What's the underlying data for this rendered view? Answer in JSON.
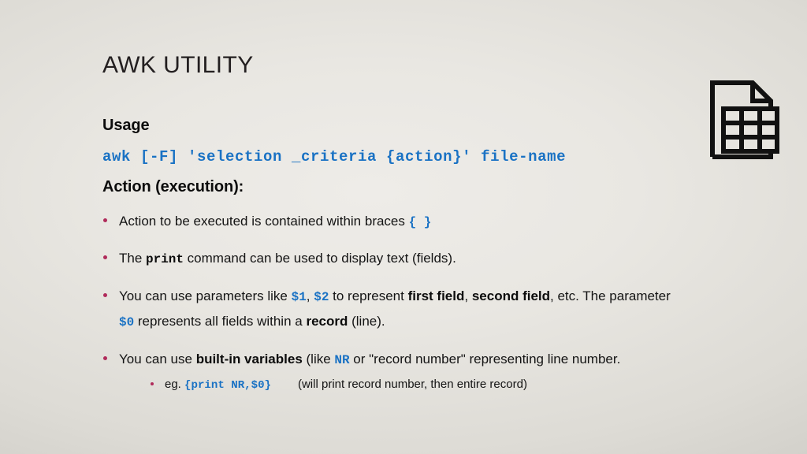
{
  "slide": {
    "title": "AWK UTILITY",
    "usage_heading": "Usage",
    "code_usage": "awk [-F] 'selection _criteria {action}' file-name",
    "action_heading": "Action (execution):",
    "bullets": [
      {
        "segments": [
          {
            "kind": "text",
            "text": "Action to be executed is contained within braces "
          },
          {
            "kind": "code-blue",
            "text": "{ }"
          }
        ]
      },
      {
        "segments": [
          {
            "kind": "text",
            "text": "The "
          },
          {
            "kind": "code-black",
            "text": "print"
          },
          {
            "kind": "text",
            "text": " command can be used to display text (fields)."
          }
        ]
      },
      {
        "segments": [
          {
            "kind": "text",
            "text": "You can use parameters like "
          },
          {
            "kind": "code-blue",
            "text": "$1"
          },
          {
            "kind": "text",
            "text": ", "
          },
          {
            "kind": "code-blue",
            "text": "$2"
          },
          {
            "kind": "text",
            "text": " to represent "
          },
          {
            "kind": "strong",
            "text": "first field"
          },
          {
            "kind": "text",
            "text": ", "
          },
          {
            "kind": "strong",
            "text": "second field"
          },
          {
            "kind": "text",
            "text": ", etc. The parameter "
          },
          {
            "kind": "code-blue",
            "text": "$0"
          },
          {
            "kind": "text",
            "text": " represents all fields within a "
          },
          {
            "kind": "strong",
            "text": "record"
          },
          {
            "kind": "text",
            "text": " (line)."
          }
        ]
      },
      {
        "segments": [
          {
            "kind": "text",
            "text": "You can use "
          },
          {
            "kind": "strong",
            "text": "built-in variables"
          },
          {
            "kind": "text",
            "text": " (like "
          },
          {
            "kind": "code-blue",
            "text": "NR"
          },
          {
            "kind": "text",
            "text": " or \"record number\" representing line number."
          }
        ]
      }
    ],
    "sub_bullet": {
      "segments": [
        {
          "kind": "text",
          "text": "eg. "
        },
        {
          "kind": "code-blue",
          "text": "{print NR,$0}"
        },
        {
          "kind": "gap",
          "text": ""
        },
        {
          "kind": "text",
          "text": "(will print record number, then entire record)"
        }
      ]
    },
    "icon": {
      "name": "spreadsheet-file-icon"
    }
  },
  "colors": {
    "accent_blue": "#1a72c4",
    "bullet_magenta": "#b02a5a",
    "text_black": "#141414",
    "background_light": "#eeece8",
    "background_edge": "#c7c5bf"
  }
}
